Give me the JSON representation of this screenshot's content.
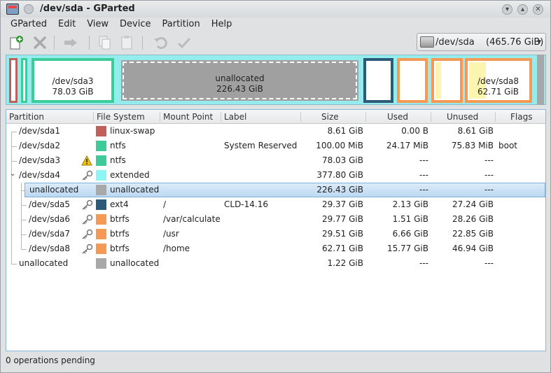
{
  "window": {
    "title": "/dev/sda - GParted"
  },
  "menu": [
    {
      "label": "GParted"
    },
    {
      "label": "Edit"
    },
    {
      "label": "View"
    },
    {
      "label": "Device"
    },
    {
      "label": "Partition"
    },
    {
      "label": "Help"
    }
  ],
  "toolbar": {
    "icons": [
      "new-partition-icon",
      "delete-icon",
      "resize-move-icon",
      "copy-icon",
      "paste-icon",
      "undo-icon",
      "apply-icon"
    ]
  },
  "device": {
    "name": "/dev/sda",
    "size": "(465.76 GiB)"
  },
  "diskmap": {
    "segments": [
      {
        "name": "sda1",
        "label": "",
        "size": "",
        "color": "#c0605a"
      },
      {
        "name": "sda2",
        "label": "",
        "size": "",
        "color": "#3ccc9a"
      },
      {
        "name": "sda3",
        "label": "/dev/sda3",
        "size": "78.03 GiB",
        "color": "#3ccc9a"
      },
      {
        "name": "unallocated",
        "label": "unallocated",
        "size": "226.43 GiB",
        "color": "#a0a0a0"
      },
      {
        "name": "sda5",
        "label": "",
        "size": "",
        "color": "#2e5a7a"
      },
      {
        "name": "sda6",
        "label": "",
        "size": "",
        "color": "#f59a56"
      },
      {
        "name": "sda7",
        "label": "",
        "size": "",
        "color": "#f59a56"
      },
      {
        "name": "sda8",
        "label": "/dev/sda8",
        "size": "62.71 GiB",
        "color": "#f59a56"
      }
    ]
  },
  "table": {
    "headers": {
      "partition": "Partition",
      "filesystem": "File System",
      "mountpoint": "Mount Point",
      "label": "Label",
      "size": "Size",
      "used": "Used",
      "unused": "Unused",
      "flags": "Flags"
    },
    "rows": [
      {
        "partition": "/dev/sda1",
        "fs": "linux-swap",
        "fs_color": "#c0605a",
        "mount": "",
        "label": "",
        "size": "8.61 GiB",
        "used": "0.00 B",
        "unused": "8.61 GiB",
        "flags": ""
      },
      {
        "partition": "/dev/sda2",
        "fs": "ntfs",
        "fs_color": "#3ccc9a",
        "mount": "",
        "label": "System Reserved",
        "size": "100.00 MiB",
        "used": "24.17 MiB",
        "unused": "75.83 MiB",
        "flags": "boot"
      },
      {
        "partition": "/dev/sda3",
        "fs": "ntfs",
        "fs_color": "#3ccc9a",
        "mount": "",
        "label": "",
        "size": "78.03 GiB",
        "used": "---",
        "unused": "---",
        "flags": ""
      },
      {
        "partition": "/dev/sda4",
        "fs": "extended",
        "fs_color": "#8ef5f5",
        "mount": "",
        "label": "",
        "size": "377.80 GiB",
        "used": "---",
        "unused": "---",
        "flags": ""
      },
      {
        "partition": "unallocated",
        "fs": "unallocated",
        "fs_color": "#a8a8a8",
        "mount": "",
        "label": "",
        "size": "226.43 GiB",
        "used": "---",
        "unused": "---",
        "flags": ""
      },
      {
        "partition": "/dev/sda5",
        "fs": "ext4",
        "fs_color": "#2e5a7a",
        "mount": "/",
        "label": "CLD-14.16",
        "size": "29.37 GiB",
        "used": "2.13 GiB",
        "unused": "27.24 GiB",
        "flags": ""
      },
      {
        "partition": "/dev/sda6",
        "fs": "btrfs",
        "fs_color": "#f59a56",
        "mount": "/var/calculate",
        "label": "",
        "size": "29.77 GiB",
        "used": "1.51 GiB",
        "unused": "28.26 GiB",
        "flags": ""
      },
      {
        "partition": "/dev/sda7",
        "fs": "btrfs",
        "fs_color": "#f59a56",
        "mount": "/usr",
        "label": "",
        "size": "29.51 GiB",
        "used": "6.66 GiB",
        "unused": "22.85 GiB",
        "flags": ""
      },
      {
        "partition": "/dev/sda8",
        "fs": "btrfs",
        "fs_color": "#f59a56",
        "mount": "/home",
        "label": "",
        "size": "62.71 GiB",
        "used": "15.77 GiB",
        "unused": "46.94 GiB",
        "flags": ""
      },
      {
        "partition": "unallocated",
        "fs": "unallocated",
        "fs_color": "#a8a8a8",
        "mount": "",
        "label": "",
        "size": "1.22 GiB",
        "used": "---",
        "unused": "---",
        "flags": ""
      }
    ]
  },
  "status": {
    "text": "0 operations pending"
  }
}
